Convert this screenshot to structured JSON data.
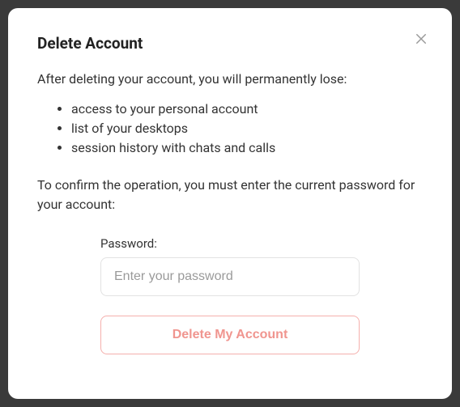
{
  "modal": {
    "title": "Delete Account",
    "intro": "After deleting your account, you will permanently lose:",
    "losses": [
      "access to your personal account",
      "list of your desktops",
      "session history with chats and calls"
    ],
    "confirm_text": "To confirm the operation, you must enter the current password for your account:",
    "password": {
      "label": "Password:",
      "placeholder": "Enter your password",
      "value": ""
    },
    "delete_button": "Delete My Account"
  }
}
